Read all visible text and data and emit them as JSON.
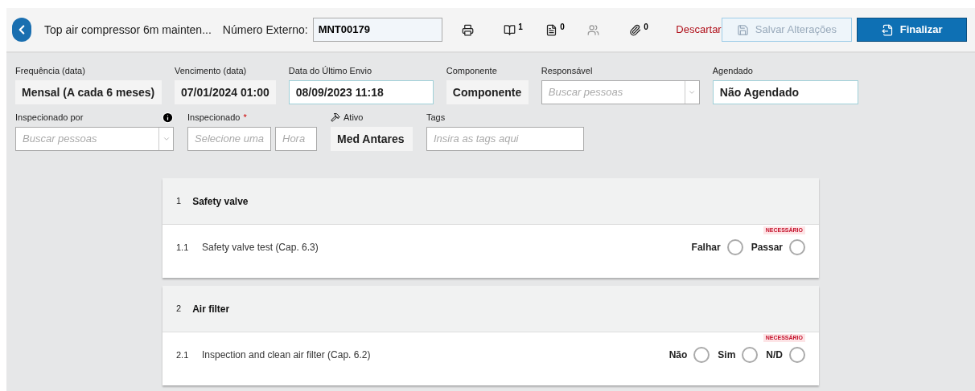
{
  "header": {
    "title": "Top air compressor 6m mainten...",
    "external_number_label": "Número Externo:",
    "external_number": "MNT00179",
    "tools": [
      {
        "kind": "printer"
      },
      {
        "kind": "book",
        "count": "1"
      },
      {
        "kind": "document",
        "count": "0"
      },
      {
        "kind": "people"
      },
      {
        "kind": "paperclip",
        "count": "0"
      }
    ],
    "discard": "Descartar",
    "save": {
      "label": "Salvar Alterações",
      "disabled": true
    },
    "finish": "Finalizar"
  },
  "fields_row_1": [
    {
      "label": "Frequência (data)",
      "kind": "static",
      "value": "Mensal (A cada 6 meses)"
    },
    {
      "label": "Vencimento (data)",
      "kind": "static",
      "value": "07/01/2024 01:00"
    },
    {
      "label": "Data do Último Envio",
      "kind": "input",
      "value": "08/09/2023 11:18"
    },
    {
      "label": "Componente",
      "kind": "static",
      "value": "Componente"
    },
    {
      "label": "Responsável",
      "kind": "select",
      "placeholder": "Buscar pessoas"
    },
    {
      "label": "Agendado",
      "kind": "input",
      "value": "Não Agendado"
    }
  ],
  "fields_row_2": [
    {
      "label": "Inspecionado por",
      "kind": "select",
      "placeholder": "Buscar pessoas",
      "info": true
    },
    {
      "label": "Inspecionado",
      "kind": "datetime",
      "required_mark": "*",
      "placeholder": "Selecione uma",
      "time_placeholder": "Hora"
    },
    {
      "label": "Ativo",
      "kind": "static",
      "value": "Med Antares",
      "asset_icon": true
    },
    {
      "label": "Tags",
      "kind": "tags",
      "placeholder": "Insira as tags aqui"
    }
  ],
  "sections": [
    {
      "number": "1",
      "title": "Safety valve",
      "items": [
        {
          "number": "1.1",
          "text": "Safety valve test (Cap. 6.3)",
          "badge": "NECESSÁRIO",
          "options": [
            {
              "label": "Falhar",
              "selected": false
            },
            {
              "label": "Passar",
              "selected": false
            }
          ]
        }
      ]
    },
    {
      "number": "2",
      "title": "Air filter",
      "items": [
        {
          "number": "2.1",
          "text": "Inspection and clean air filter (Cap. 6.2)",
          "badge": "NECESSÁRIO",
          "options": [
            {
              "label": "Não",
              "selected": false
            },
            {
              "label": "Sim",
              "selected": false
            },
            {
              "label": "N/D",
              "selected": false
            }
          ]
        }
      ]
    }
  ]
}
